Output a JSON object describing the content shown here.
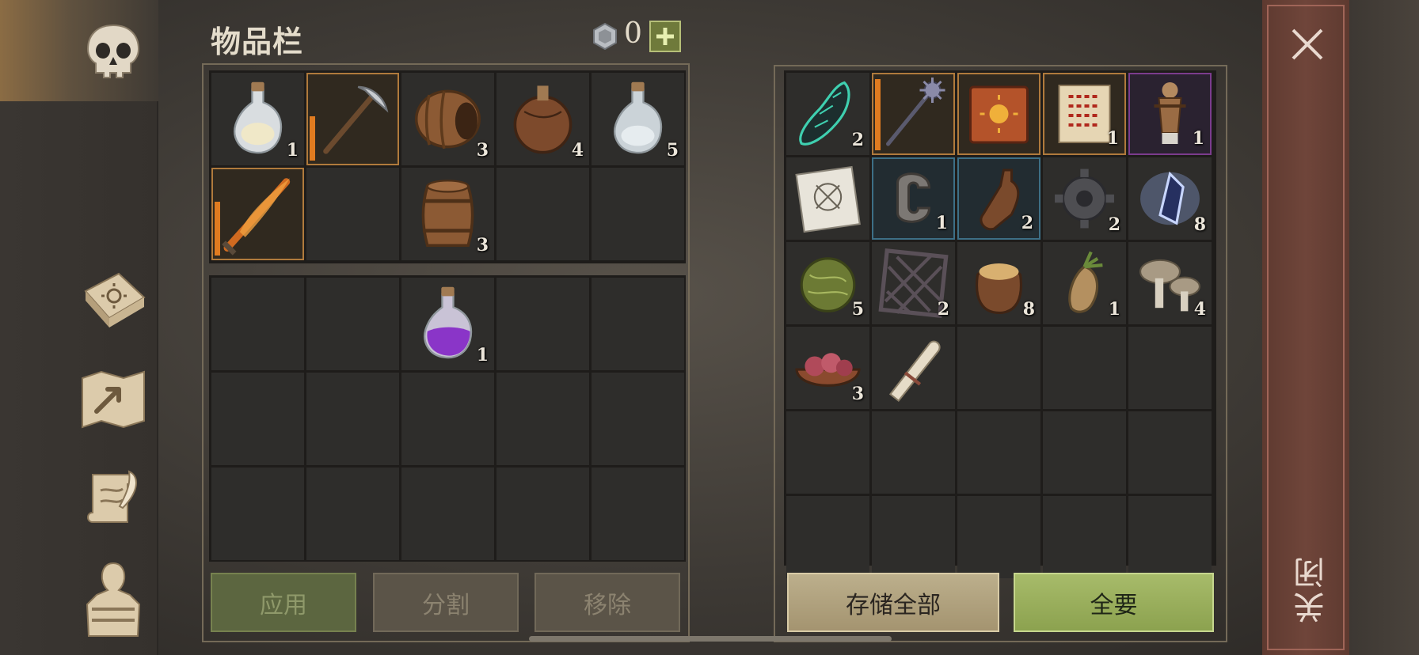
{
  "window": {
    "title": "物品栏"
  },
  "currency": {
    "icon": "silver-coin-icon",
    "value": "0",
    "add_icon": "plus-icon"
  },
  "nav": {
    "items": [
      {
        "name": "skull",
        "icon": "skull-icon",
        "active": true
      },
      {
        "name": "recipes",
        "icon": "sun-book-icon",
        "active": false
      },
      {
        "name": "map",
        "icon": "map-icon",
        "active": false
      },
      {
        "name": "quests",
        "icon": "quill-scroll-icon",
        "active": false
      },
      {
        "name": "character",
        "icon": "character-silhouette-icon",
        "active": false
      }
    ]
  },
  "inventory": {
    "rows": [
      [
        {
          "icon": "white-potion-icon",
          "qty": "1"
        },
        {
          "icon": "pickaxe-icon",
          "qty": "",
          "state": "selected",
          "durability": 0.5
        },
        {
          "icon": "barrel-open-icon",
          "qty": "3"
        },
        {
          "icon": "leather-flask-icon",
          "qty": "4"
        },
        {
          "icon": "clear-potion-icon",
          "qty": "5"
        }
      ],
      [
        {
          "icon": "flame-sword-icon",
          "qty": "",
          "state": "selected",
          "durability": 0.6
        },
        {
          "icon": "",
          "qty": ""
        },
        {
          "icon": "barrel-icon",
          "qty": "3"
        },
        {
          "icon": "",
          "qty": ""
        },
        {
          "icon": "",
          "qty": ""
        }
      ]
    ]
  },
  "bag": {
    "rows": [
      [
        {
          "icon": "",
          "qty": ""
        },
        {
          "icon": "",
          "qty": ""
        },
        {
          "icon": "purple-potion-icon",
          "qty": "1"
        },
        {
          "icon": "",
          "qty": ""
        },
        {
          "icon": "",
          "qty": ""
        }
      ],
      [
        {
          "icon": "",
          "qty": ""
        },
        {
          "icon": "",
          "qty": ""
        },
        {
          "icon": "",
          "qty": ""
        },
        {
          "icon": "",
          "qty": ""
        },
        {
          "icon": "",
          "qty": ""
        }
      ],
      [
        {
          "icon": "",
          "qty": ""
        },
        {
          "icon": "",
          "qty": ""
        },
        {
          "icon": "",
          "qty": ""
        },
        {
          "icon": "",
          "qty": ""
        },
        {
          "icon": "",
          "qty": ""
        }
      ]
    ]
  },
  "storage": {
    "rows": [
      [
        {
          "icon": "green-crystal-shard-icon",
          "qty": "2"
        },
        {
          "icon": "spiked-mace-icon",
          "qty": "",
          "state": "selected",
          "durability": 0.9
        },
        {
          "icon": "sun-tome-icon",
          "qty": "",
          "state": "selected"
        },
        {
          "icon": "rune-scroll-icon",
          "qty": "1",
          "state": "selected"
        },
        {
          "icon": "training-dummy-icon",
          "qty": "1",
          "state": "rare"
        }
      ],
      [
        {
          "icon": "blueprint-icon",
          "qty": ""
        },
        {
          "icon": "iron-clamp-icon",
          "qty": "1",
          "state": "uncommon"
        },
        {
          "icon": "clay-bottle-icon",
          "qty": "2",
          "state": "uncommon"
        },
        {
          "icon": "gear-icon",
          "qty": "2"
        },
        {
          "icon": "glowing-crystal-icon",
          "qty": "8"
        }
      ],
      [
        {
          "icon": "herb-ball-icon",
          "qty": "5"
        },
        {
          "icon": "iron-grate-icon",
          "qty": "2"
        },
        {
          "icon": "grain-sack-icon",
          "qty": "8"
        },
        {
          "icon": "mandrake-root-icon",
          "qty": "1"
        },
        {
          "icon": "mushrooms-icon",
          "qty": "4"
        }
      ],
      [
        {
          "icon": "raw-meat-bowl-icon",
          "qty": "3"
        },
        {
          "icon": "bandage-roll-icon",
          "qty": ""
        },
        {
          "icon": "",
          "qty": ""
        },
        {
          "icon": "",
          "qty": ""
        },
        {
          "icon": "",
          "qty": ""
        }
      ],
      [
        {
          "icon": "",
          "qty": ""
        },
        {
          "icon": "",
          "qty": ""
        },
        {
          "icon": "",
          "qty": ""
        },
        {
          "icon": "",
          "qty": ""
        },
        {
          "icon": "",
          "qty": ""
        }
      ],
      [
        {
          "icon": "",
          "qty": ""
        },
        {
          "icon": "",
          "qty": ""
        },
        {
          "icon": "",
          "qty": ""
        },
        {
          "icon": "",
          "qty": ""
        },
        {
          "icon": "",
          "qty": ""
        }
      ]
    ]
  },
  "actions": {
    "apply": "应用",
    "split": "分割",
    "remove": "移除",
    "store_all": "存储全部",
    "take_all": "全要"
  },
  "close": {
    "label": "关闭",
    "icon": "close-icon"
  },
  "colors": {
    "durability": "#e07b20",
    "selected_border": "#b07a3c",
    "uncommon_border": "#3d6f86",
    "rare_border": "#7b3c8d",
    "take_all": "#9db05c",
    "store_all": "#b4a680"
  }
}
